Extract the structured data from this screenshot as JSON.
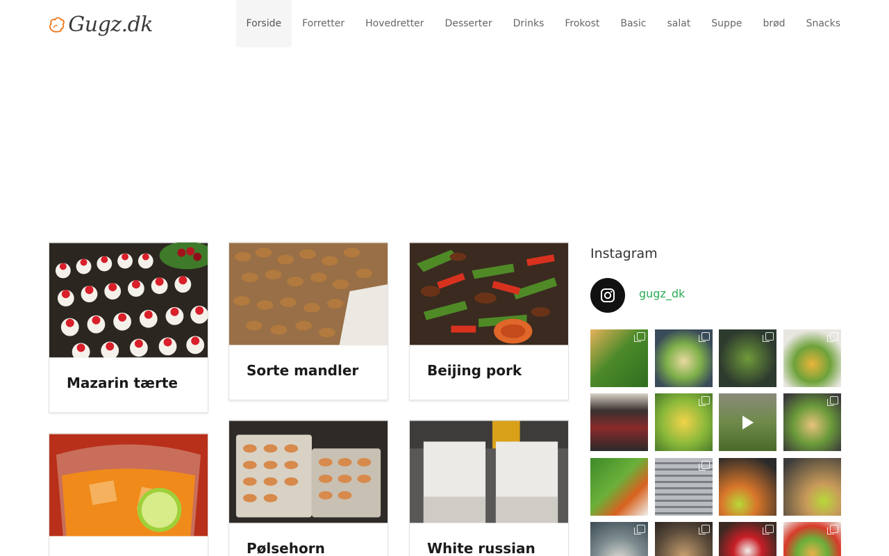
{
  "brand": {
    "logo_text": "Gugz.dk",
    "accent": "#f07a1e"
  },
  "nav": [
    {
      "label": "Forside",
      "active": true
    },
    {
      "label": "Forretter"
    },
    {
      "label": "Hovedretter"
    },
    {
      "label": "Desserter"
    },
    {
      "label": "Drinks"
    },
    {
      "label": "Frokost"
    },
    {
      "label": "Basic"
    },
    {
      "label": "salat"
    },
    {
      "label": "Suppe"
    },
    {
      "label": "brød"
    },
    {
      "label": "Snacks"
    }
  ],
  "posts": [
    {
      "title": "Mazarin tærte"
    },
    {
      "title": "Sorte mandler"
    },
    {
      "title": "Beijing pork"
    },
    {
      "title": ""
    },
    {
      "title": "Pølsehorn"
    },
    {
      "title": "White russian"
    }
  ],
  "sidebar": {
    "heading": "Instagram",
    "username": "gugz_dk",
    "avatar_icon": "instagram-icon",
    "link_color": "#2aaa55"
  }
}
